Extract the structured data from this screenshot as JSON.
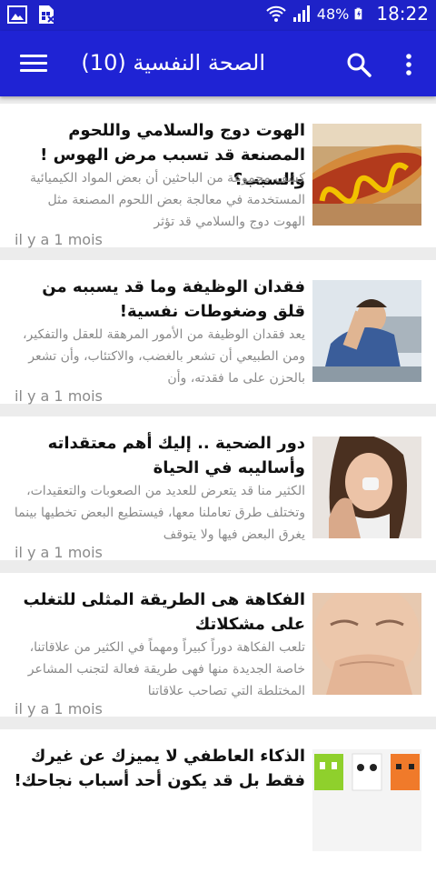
{
  "status_bar": {
    "battery_percent": "48%",
    "time": "18:22",
    "icons": [
      "gallery-icon",
      "sim-card-icon",
      "wifi-icon",
      "signal-icon",
      "battery-charging-icon"
    ]
  },
  "app_bar": {
    "title": "الصحة النفسية (10)",
    "icons": [
      "menu-icon",
      "search-icon",
      "more-vert-icon"
    ]
  },
  "articles": [
    {
      "title": "الهوت دوج والسلامي واللحوم المصنعة قد تسبب مرض الهوس ! والسبب؟",
      "excerpt": "كشف مجموعة من الباحثين أن بعض المواد الكيميائية المستخدمة في معالجة بعض اللحوم المصنعة مثل الهوت دوج والسلامي قد تؤثر",
      "date": "il y a 1 mois",
      "image": "hot-dog-photo"
    },
    {
      "title": "فقدان الوظيفة وما قد يسببه من قلق وضغوطات نفسية!",
      "excerpt": "يعد فقدان الوظيفة من الأمور المرهقة للعقل والتفكير، ومن الطبيعي أن تشعر بالغضب، والاكتئاب، وأن تشعر بالحزن على ما فقدته، وأن",
      "date": "il y a 1 mois",
      "image": "stressed-man-photo"
    },
    {
      "title": "دور الضحية .. إليك أهم معتقداته وأساليبه في الحياة",
      "excerpt": "الكثير منا قد يتعرض للعديد من الصعوبات والتعقيدات، وتختلف طرق تعاملنا معها، فيستطيع البعض تخطيها بينما يغرق البعض فيها ولا يتوقف",
      "date": "il y a 1 mois",
      "image": "crying-woman-photo"
    },
    {
      "title": "الفكاهة هى الطريقة المثلى للتغلب على مشكلاتك",
      "excerpt": "تلعب الفكاهة دوراً كبيراً ومهماً في الكثير من علاقاتنا، خاصة الجديدة منها فهى طريقة فعالة لتجنب المشاعر المختلطة التي تصاحب علاقاتنا",
      "date": "il y a 1 mois",
      "image": "laughing-woman-photo"
    },
    {
      "title": "الذكاء العاطفي لا يميزك عن غيرك فقط بل قد يكون أحد أسباب نجاحك!",
      "excerpt": "",
      "date": "",
      "image": "emoji-faces-photo"
    }
  ]
}
